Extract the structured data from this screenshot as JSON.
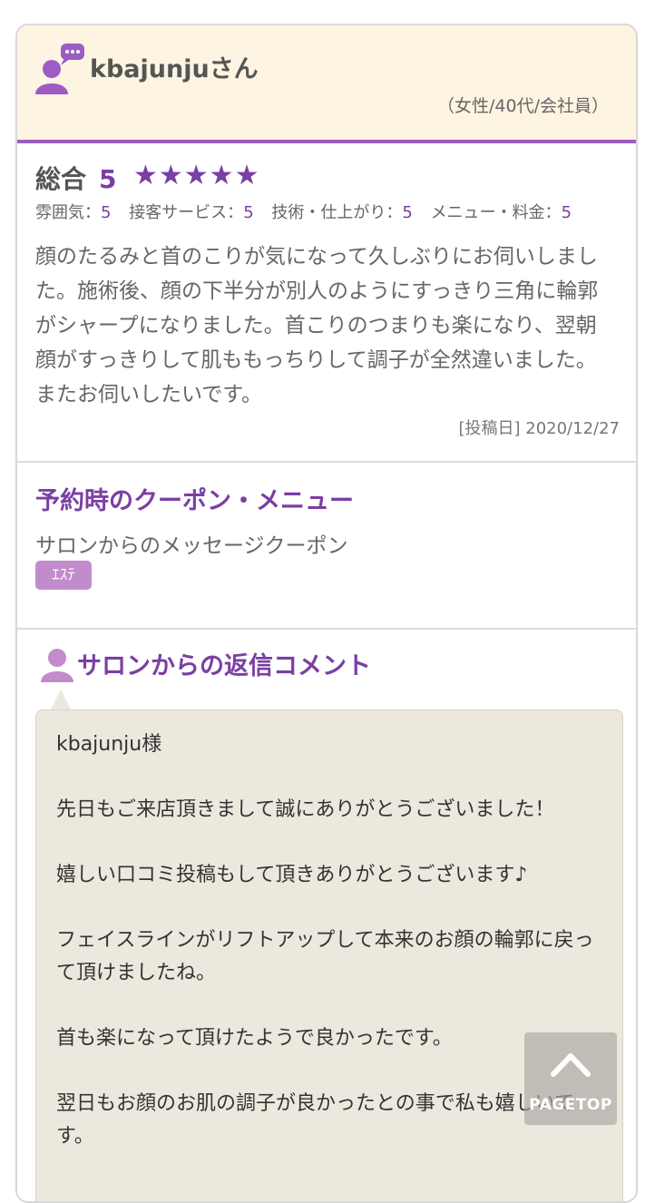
{
  "reviewer": {
    "name": "kbajunjuさん",
    "meta": "（女性/40代/会社員）"
  },
  "rating": {
    "overall_label": "総合",
    "overall_score": "5",
    "stars": "★★★★★",
    "sub": [
      {
        "label": "雰囲気：",
        "value": "5"
      },
      {
        "label": "接客サービス：",
        "value": "5"
      },
      {
        "label": "技術・仕上がり：",
        "value": "5"
      },
      {
        "label": "メニュー・料金：",
        "value": "5"
      }
    ]
  },
  "review": {
    "text": "顔のたるみと首のこりが気になって久しぶりにお伺いしました。施術後、顔の下半分が別人のようにすっきり三角に輪郭がシャープになりました。首こりのつまりも楽になり、翌朝顔がすっきりして肌ももっちりして調子が全然違いました。またお伺いしたいです。",
    "post_date": "[投稿日] 2020/12/27"
  },
  "coupon": {
    "title": "予約時のクーポン・メニュー",
    "name": "サロンからのメッセージクーポン",
    "tag": "ｴｽﾃ"
  },
  "reply": {
    "title": "サロンからの返信コメント",
    "lines": [
      "kbajunju様",
      "先日もご来店頂きまして誠にありがとうございました！",
      "嬉しい口コミ投稿もして頂きありがとうございます♪",
      "フェイスラインがリフトアップして本来のお顔の輪郭に戻って頂けましたね。",
      "首も楽になって頂けたようで良かったです。",
      "翌日もお顔のお肌の調子が良かったとの事で私も嬉しいです。"
    ]
  },
  "pagetop": {
    "label": "PAGETOP"
  },
  "colors": {
    "accent": "#7a3fa3",
    "header_bg": "#fdf4e2",
    "bubble_bg": "#ece8dd",
    "tag_bg": "#c28bcb"
  }
}
